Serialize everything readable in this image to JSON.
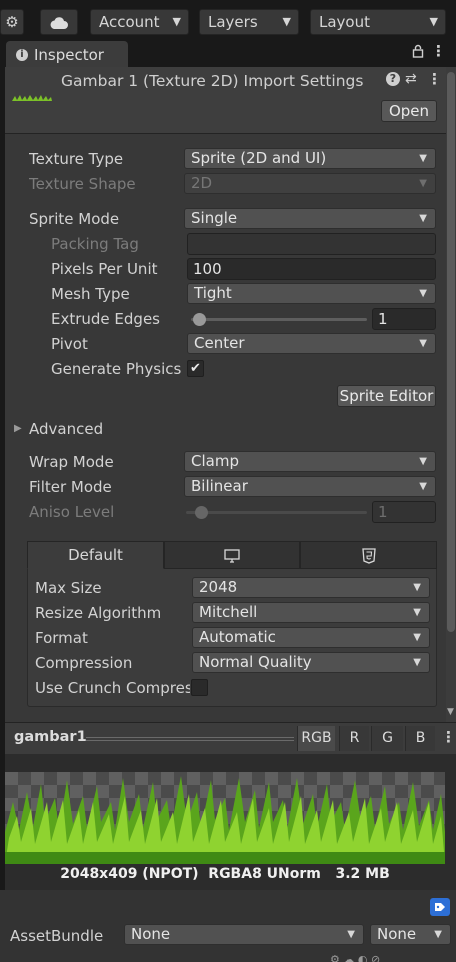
{
  "toolbar": {
    "account_label": "Account",
    "layers_label": "Layers",
    "layout_label": "Layout"
  },
  "inspector": {
    "tab_label": "Inspector",
    "title": "Gambar 1 (Texture 2D) Import Settings",
    "open_label": "Open"
  },
  "settings": {
    "texture_type_label": "Texture Type",
    "texture_type_value": "Sprite (2D and UI)",
    "texture_shape_label": "Texture Shape",
    "texture_shape_value": "2D",
    "sprite_mode_label": "Sprite Mode",
    "sprite_mode_value": "Single",
    "packing_tag_label": "Packing Tag",
    "packing_tag_value": "",
    "pixels_per_unit_label": "Pixels Per Unit",
    "pixels_per_unit_value": "100",
    "mesh_type_label": "Mesh Type",
    "mesh_type_value": "Tight",
    "extrude_edges_label": "Extrude Edges",
    "extrude_edges_value": "1",
    "pivot_label": "Pivot",
    "pivot_value": "Center",
    "generate_physics_label": "Generate Physics S",
    "generate_physics_checked": true,
    "sprite_editor_label": "Sprite Editor",
    "advanced_label": "Advanced",
    "wrap_mode_label": "Wrap Mode",
    "wrap_mode_value": "Clamp",
    "filter_mode_label": "Filter Mode",
    "filter_mode_value": "Bilinear",
    "aniso_level_label": "Aniso Level",
    "aniso_level_value": "1"
  },
  "platform": {
    "default_tab_label": "Default",
    "max_size_label": "Max Size",
    "max_size_value": "2048",
    "resize_label": "Resize Algorithm",
    "resize_value": "Mitchell",
    "format_label": "Format",
    "format_value": "Automatic",
    "compression_label": "Compression",
    "compression_value": "Normal Quality",
    "crunch_label": "Use Crunch Compres",
    "crunch_checked": false
  },
  "preview": {
    "name": "gambar1",
    "channels": [
      "RGB",
      "R",
      "G",
      "B"
    ],
    "active_channel": "RGB",
    "info": "2048x409 (NPOT)  RGBA8 UNorm   3.2 MB"
  },
  "asset_bundle": {
    "label": "AssetBundle",
    "bundle_value": "None",
    "variant_value": "None"
  }
}
